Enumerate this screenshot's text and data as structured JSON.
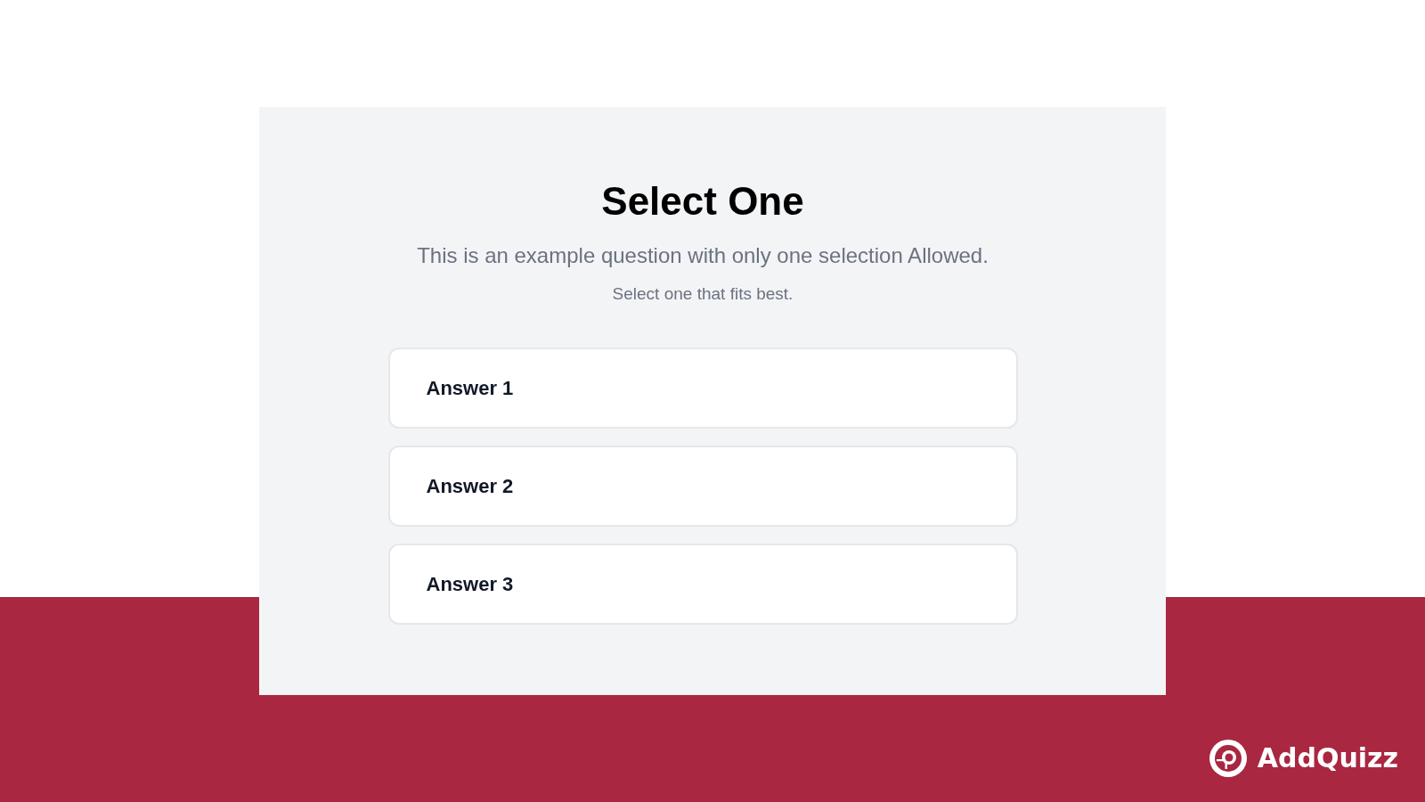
{
  "quiz": {
    "title": "Select One",
    "question": "This is an example question with only one selection Allowed.",
    "hint": "Select one that fits best.",
    "answers": [
      {
        "label": "Answer 1",
        "selected": false
      },
      {
        "label": "Answer 2",
        "selected": false
      },
      {
        "label": "Answer 3",
        "selected": false
      }
    ]
  },
  "brand": {
    "name": "AddQuizz"
  }
}
